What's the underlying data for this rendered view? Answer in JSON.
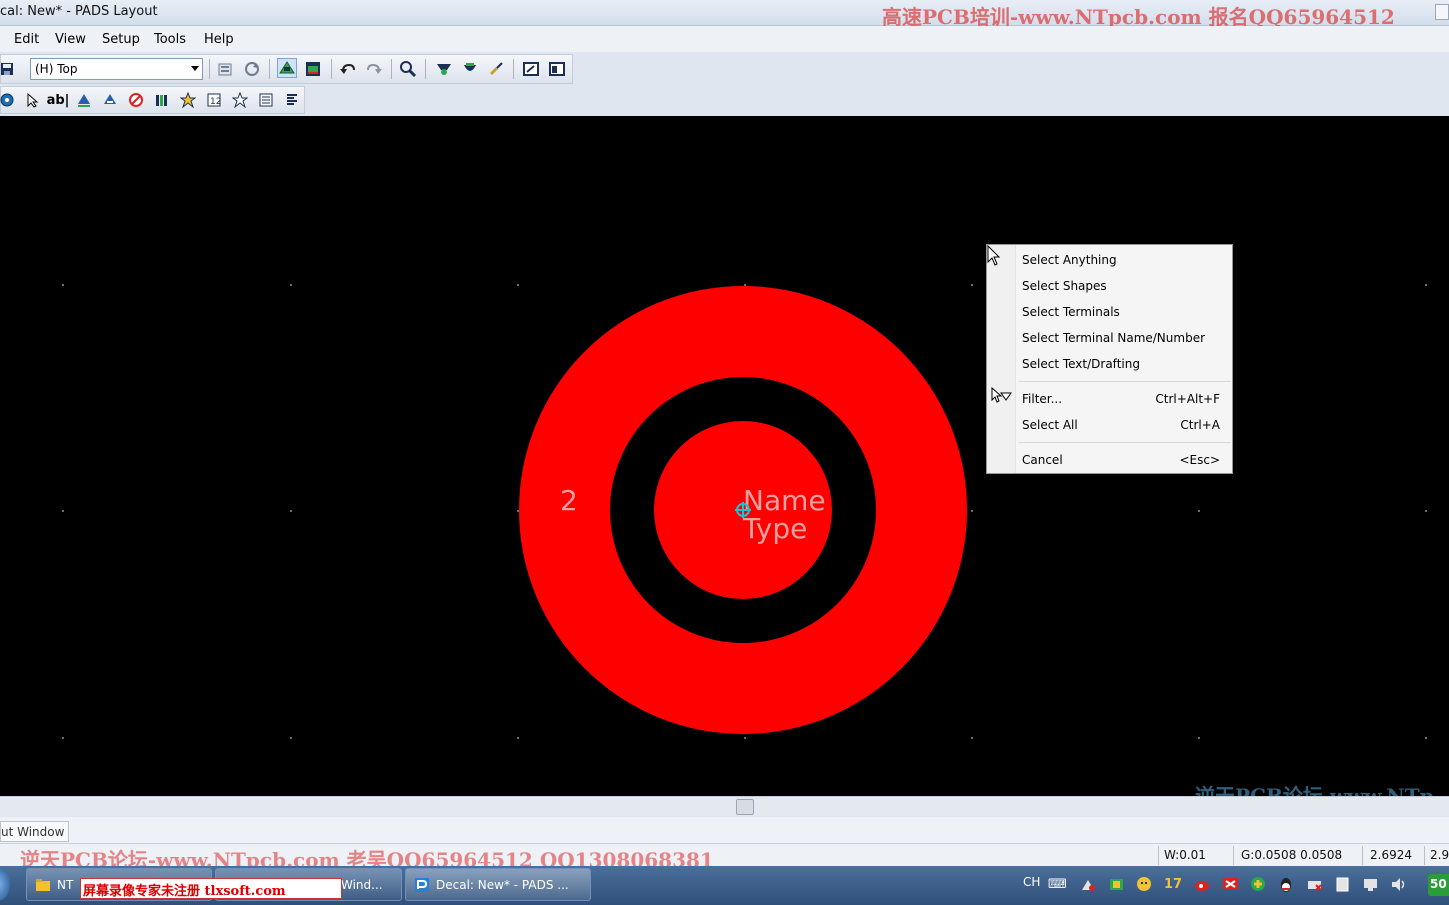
{
  "window": {
    "title": "cal: New* - PADS Layout",
    "watermark_top": "高速PCB培训-www.NTpcb.com  报名QQ65964512"
  },
  "menu": {
    "edit": "Edit",
    "view": "View",
    "setup": "Setup",
    "tools": "Tools",
    "help": "Help"
  },
  "toolbar": {
    "layer_value": "(H) Top"
  },
  "canvas": {
    "terminal_number": "2",
    "label_name": "Name",
    "label_type": "Type",
    "colors": {
      "background": "#000000",
      "pad": "#ff0000",
      "origin": "#19c2d6",
      "text": "#e8a0a0"
    }
  },
  "context_menu": {
    "items": [
      {
        "label": "Select Anything",
        "shortcut": ""
      },
      {
        "label": "Select Shapes",
        "shortcut": ""
      },
      {
        "label": "Select Terminals",
        "shortcut": ""
      },
      {
        "label": "Select Terminal Name/Number",
        "shortcut": ""
      },
      {
        "label": "Select Text/Drafting",
        "shortcut": ""
      },
      {
        "label": "Filter...",
        "shortcut": "Ctrl+Alt+F"
      },
      {
        "label": "Select All",
        "shortcut": "Ctrl+A"
      },
      {
        "label": "Cancel",
        "shortcut": "<Esc>"
      }
    ]
  },
  "output": {
    "tab_label": "ut Window"
  },
  "status": {
    "watermark": "逆天PCB论坛-www.NTpcb.com  老吴QQ65964512  QQ1308068381",
    "width": "W:0.01",
    "grid": "G:0.0508 0.0508",
    "x": "2.6924",
    "y": "2.9"
  },
  "canvas_watermark": "逆天PCB论坛 www.NTp",
  "taskbar": {
    "btn1": "NT",
    "btn2": "Wind...",
    "btn3": "Decal: New* - PADS ...",
    "reg_banner": "屏幕录像专家未注册 tlxsoft.com",
    "lang": "CH",
    "clock": "50",
    "tray_number": "17"
  }
}
